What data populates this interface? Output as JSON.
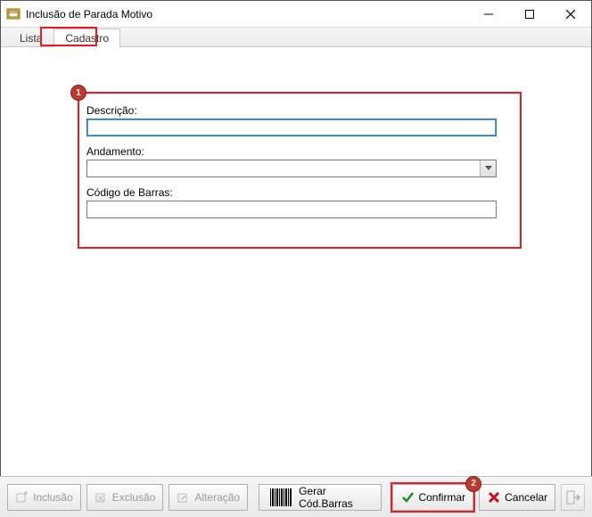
{
  "window": {
    "title": "Inclusão de Parada Motivo"
  },
  "tabs": {
    "lista": "Lista",
    "cadastro": "Cadastro"
  },
  "form": {
    "descricao_label": "Descrição:",
    "descricao_value": "",
    "andamento_label": "Andamento:",
    "andamento_value": "",
    "codigobarras_label": "Código de Barras:",
    "codigobarras_value": ""
  },
  "toolbar": {
    "inclusao": "Inclusão",
    "exclusao": "Exclusão",
    "alteracao": "Alteração",
    "gerarcodbarras": "Gerar Cód.Barras",
    "confirmar": "Confirmar",
    "cancelar": "Cancelar"
  },
  "markers": {
    "one": "1",
    "two": "2"
  }
}
